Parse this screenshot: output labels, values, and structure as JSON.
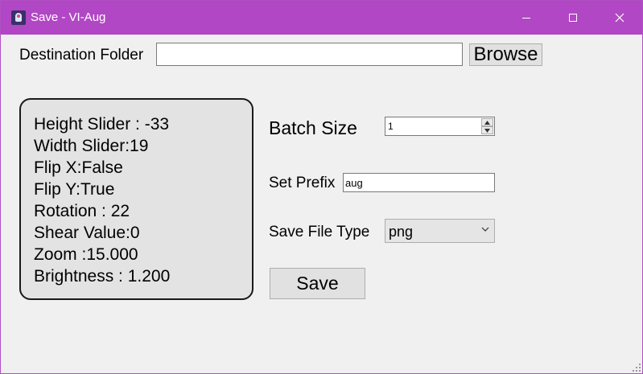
{
  "window": {
    "title": "Save - VI-Aug",
    "minimize_icon": "minimize-icon",
    "maximize_icon": "maximize-icon",
    "close_icon": "close-icon",
    "titlebar_color": "#b147c4"
  },
  "destination": {
    "label": "Destination Folder",
    "value": "",
    "browse_label": "Browse"
  },
  "info": {
    "lines": [
      "Height Slider : -33",
      "Width Slider:19",
      "Flip X:False",
      "Flip Y:True",
      "Rotation : 22",
      "Shear Value:0",
      "Zoom :15.000",
      "Brightness : 1.200"
    ]
  },
  "batch": {
    "label": "Batch Size",
    "value": "1"
  },
  "prefix": {
    "label": "Set Prefix",
    "value": "aug"
  },
  "file_type": {
    "label": "Save File Type",
    "selected": "png"
  },
  "actions": {
    "save_label": "Save"
  }
}
